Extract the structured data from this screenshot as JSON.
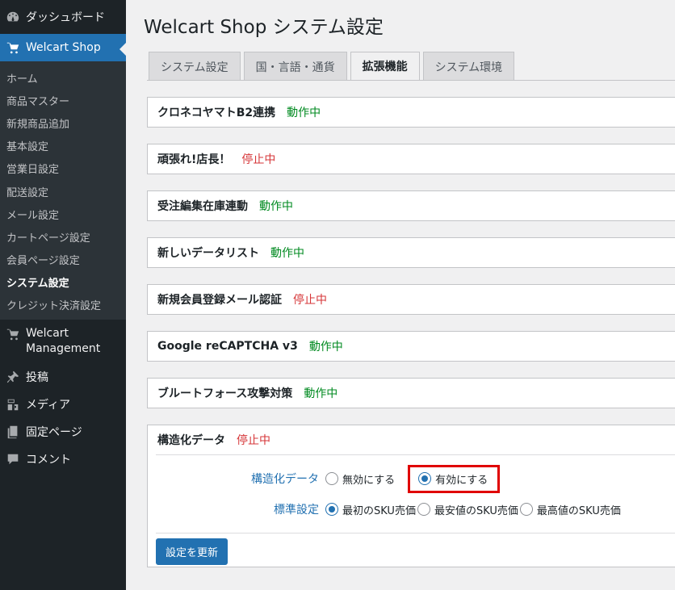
{
  "sidebar": {
    "dashboard": "ダッシュボード",
    "welcart_shop": "Welcart Shop",
    "submenu": [
      "ホーム",
      "商品マスター",
      "新規商品追加",
      "基本設定",
      "営業日設定",
      "配送設定",
      "メール設定",
      "カートページ設定",
      "会員ページ設定",
      "システム設定",
      "クレジット決済設定"
    ],
    "current_submenu": "システム設定",
    "welcart_management_line1": "Welcart",
    "welcart_management_line2": "Management",
    "posts": "投稿",
    "media": "メディア",
    "pages": "固定ページ",
    "comments": "コメント"
  },
  "page": {
    "title": "Welcart Shop システム設定",
    "tabs": [
      "システム設定",
      "国・言語・通貨",
      "拡張機能",
      "システム環境"
    ],
    "active_tab": "拡張機能"
  },
  "extensions": [
    {
      "name": "クロネコヤマトB2連携",
      "status": "動作中",
      "state": "on"
    },
    {
      "name": "頑張れ!店長！",
      "status": "停止中",
      "state": "off"
    },
    {
      "name": "受注編集在庫連動",
      "status": "動作中",
      "state": "on"
    },
    {
      "name": "新しいデータリスト",
      "status": "動作中",
      "state": "on"
    },
    {
      "name": "新規会員登録メール認証",
      "status": "停止中",
      "state": "off"
    },
    {
      "name": "Google reCAPTCHA v3",
      "status": "動作中",
      "state": "on"
    },
    {
      "name": "ブルートフォース攻撃対策",
      "status": "動作中",
      "state": "on"
    },
    {
      "name": "構造化データ",
      "status": "停止中",
      "state": "off"
    }
  ],
  "structured_data": {
    "label": "構造化データ",
    "options": [
      "無効にする",
      "有効にする"
    ],
    "selected": "有効にする",
    "standard_label": "標準設定",
    "standard_options": [
      "最初のSKU売価",
      "最安値のSKU売価",
      "最高値のSKU売価"
    ],
    "standard_selected": "最初のSKU売価",
    "update_button": "設定を更新"
  },
  "colors": {
    "accent": "#2271b1",
    "active_status": "#008a20",
    "stopped_status": "#d63638",
    "highlight": "#e00000",
    "sidebar_bg": "#1d2327"
  }
}
